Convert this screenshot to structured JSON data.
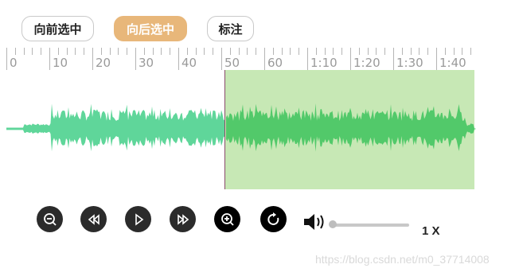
{
  "toolbar": {
    "select_before_label": "向前选中",
    "select_after_label": "向后选中",
    "mark_label": "标注",
    "active_button": "select_after"
  },
  "timeline": {
    "labels": [
      "0",
      "10",
      "20",
      "30",
      "40",
      "50",
      "60",
      "1:10",
      "1:20",
      "1:30",
      "1:40"
    ]
  },
  "waveform": {
    "color_unselected": "#5fd69a",
    "color_selected": "#52c96a",
    "selection_color": "#c7e8b5",
    "cursor_color": "#8a4b6a"
  },
  "controls": {
    "icons": [
      "zoom-out-icon",
      "rewind-icon",
      "play-icon",
      "fast-forward-icon",
      "zoom-in-icon",
      "reload-icon",
      "volume-icon"
    ],
    "volume_level": 0.0,
    "playback_rate": "1 X"
  },
  "watermark": "https://blog.csdn.net/m0_37714008",
  "colors": {
    "accent": "#e8b77a",
    "control_bg": "#2b2b2b"
  }
}
